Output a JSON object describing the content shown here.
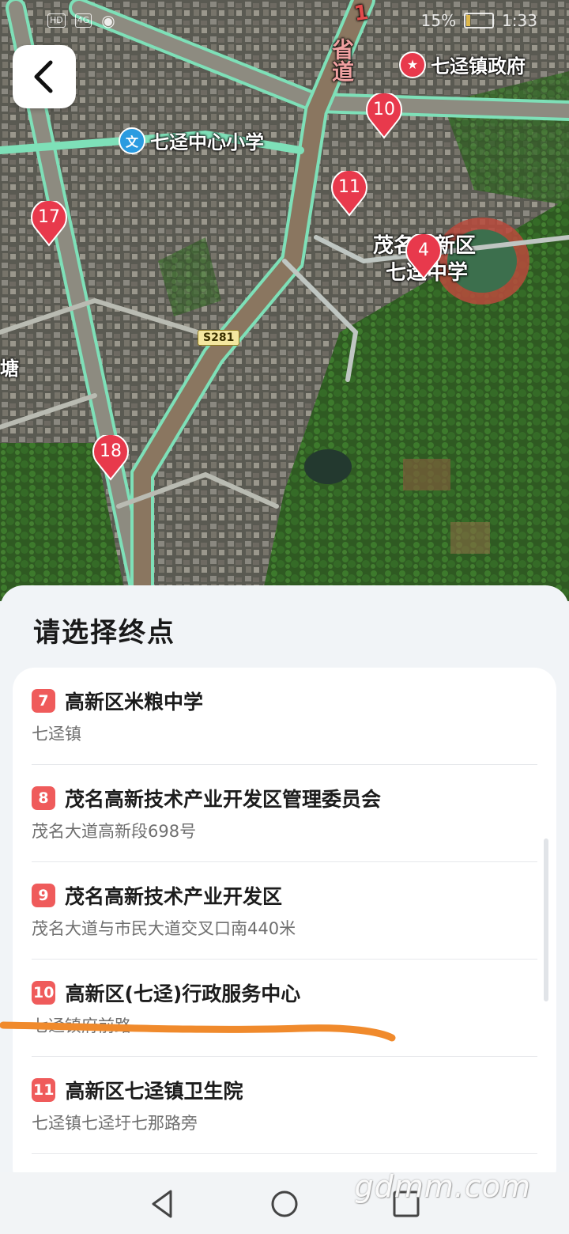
{
  "status_bar": {
    "left_chip_1": "HD",
    "left_chip_2": "4G",
    "battery": "15%",
    "time": "1:33"
  },
  "map": {
    "back_label": "back",
    "labels": {
      "province_road": "省道",
      "province_road_num": "1",
      "town_gov": "七迳镇政府",
      "school_primary": "七迳中心小学",
      "school_middle_line1": "茂名高新区",
      "school_middle_line2": "七迳中学",
      "left_edge": "塘",
      "road_shield": "S281"
    },
    "markers": [
      "10",
      "11",
      "4",
      "17",
      "18"
    ]
  },
  "sheet": {
    "title": "请选择终点",
    "items": [
      {
        "num": "7",
        "name": "高新区米粮中学",
        "address": "七迳镇"
      },
      {
        "num": "8",
        "name": "茂名高新技术产业开发区管理委员会",
        "address": "茂名大道高新段698号"
      },
      {
        "num": "9",
        "name": "茂名高新技术产业开发区",
        "address": "茂名大道与市民大道交叉口南440米"
      },
      {
        "num": "10",
        "name": "高新区(七迳)行政服务中心",
        "address": "七迳镇府前路"
      },
      {
        "num": "11",
        "name": "高新区七迳镇卫生院",
        "address": "七迳镇七迳圩七那路旁"
      }
    ]
  },
  "watermark": "gdmm.com",
  "colors": {
    "badge_red": "#ef5b5b",
    "scribble_orange": "#f08a2c",
    "road_green": "#7ee0b8"
  }
}
